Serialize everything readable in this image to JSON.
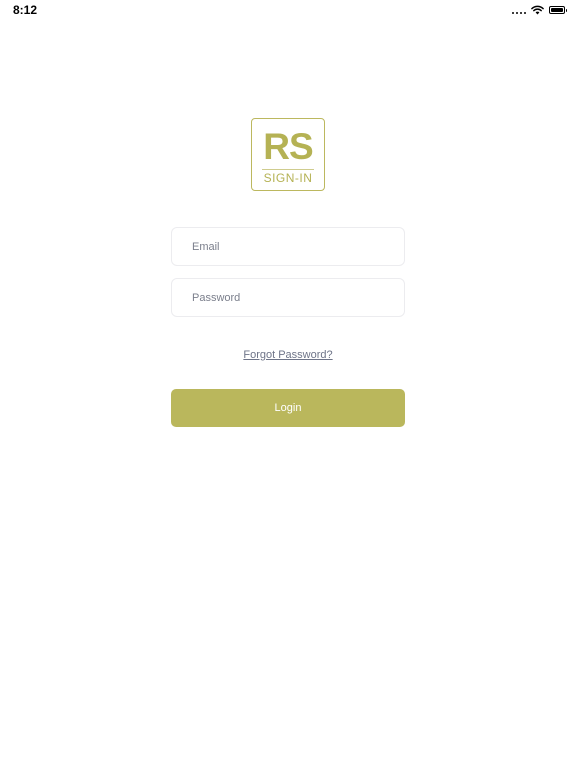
{
  "status_bar": {
    "time": "8:12",
    "icons": [
      "cellular-dots-icon",
      "wifi-icon",
      "battery-icon"
    ]
  },
  "logo": {
    "mark": "RS",
    "subtitle": "SIGN-IN"
  },
  "form": {
    "email_placeholder": "Email",
    "password_placeholder": "Password",
    "email_value": "",
    "password_value": "",
    "forgot_label": "Forgot Password?",
    "login_label": "Login"
  },
  "colors": {
    "brand": "#bab75c",
    "link": "#6e7488",
    "field_border": "#ececef"
  }
}
